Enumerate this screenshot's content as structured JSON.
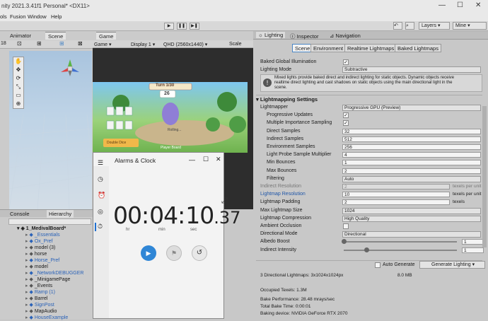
{
  "window": {
    "title": "nity 2021.3.41f1 Personal* <DX11>",
    "min": "—",
    "max": "☐",
    "close": "✕"
  },
  "menu": [
    "ols",
    "Fusion",
    "Window",
    "Help"
  ],
  "toolbar": {
    "play": "▶",
    "pause": "❚❚",
    "step": "▶❚",
    "layers": "Layers",
    "layout": "Mine"
  },
  "left_tabs": [
    "Animator",
    "Scene"
  ],
  "game_tab": {
    "label": "Game",
    "game_dropdown": "Game",
    "display": "Display 1",
    "resolution": "QHD (2560x1440)",
    "scale": "Scale"
  },
  "scene_toolbar_number": "18",
  "game_overlay": {
    "turn": "Turn 1/30",
    "score": "26",
    "rolling": "Rolling...",
    "player_board": "Player Board",
    "double_dice": "Double Dice"
  },
  "clock": {
    "title": "Alarms & Clock",
    "time": {
      "hours": "00",
      "minutes": "04",
      "seconds": "10",
      "hundredths": ".37",
      "hr": "hr",
      "min": "min",
      "sec": "sec"
    },
    "controls": {
      "play": "▶",
      "flag": "⚑",
      "reset": "↺"
    }
  },
  "bottom_tabs": [
    "Console",
    "Hierarchy"
  ],
  "hierarchy": {
    "root": "1_MedivalBoard*",
    "items": [
      {
        "label": "_Essentials",
        "blue": true
      },
      {
        "label": "Ox_Pref",
        "blue": true
      },
      {
        "label": "model (3)",
        "blue": false
      },
      {
        "label": "horse",
        "blue": false
      },
      {
        "label": "Horse_Pref",
        "blue": true
      },
      {
        "label": "model",
        "blue": false
      },
      {
        "label": "_NetworkDEBUGGER",
        "blue": true
      },
      {
        "label": "_MinigamePage",
        "blue": false
      },
      {
        "label": "_Events",
        "blue": false
      },
      {
        "label": "Ramp (1)",
        "blue": true
      },
      {
        "label": "Barrel",
        "blue": false
      },
      {
        "label": "SignPost",
        "blue": true
      },
      {
        "label": "MapAudio",
        "blue": false
      },
      {
        "label": "HouseExample",
        "blue": true
      }
    ]
  },
  "right_tabs": [
    "Lighting",
    "Inspector",
    "Navigation"
  ],
  "lighting": {
    "sub_tabs": [
      "Scene",
      "Environment",
      "Realtime Lightmaps",
      "Baked Lightmaps"
    ],
    "baked_gi_label": "Baked Global Illumination",
    "lighting_mode_label": "Lighting Mode",
    "lighting_mode_value": "Subtractive",
    "help_text": [
      "Mixed lights provide baked direct and indirect lighting for static objects. Dynamic objects receive",
      "realtime direct lighting and cast shadows on static objects using the main directional light in the",
      "scene."
    ],
    "section_title": "Lightmapping Settings",
    "rows": [
      {
        "label": "Lightmapper",
        "type": "dropdown",
        "value": "Progressive GPU (Preview)",
        "indent": 0
      },
      {
        "label": "Progressive Updates",
        "type": "check",
        "value": "✓",
        "indent": 1
      },
      {
        "label": "Multiple Importance Sampling",
        "type": "check",
        "value": "✓",
        "indent": 1
      },
      {
        "label": "Direct Samples",
        "type": "field",
        "value": "32",
        "indent": 1
      },
      {
        "label": "Indirect Samples",
        "type": "field",
        "value": "512",
        "indent": 1
      },
      {
        "label": "Environment Samples",
        "type": "field",
        "value": "256",
        "indent": 1
      },
      {
        "label": "Light Probe Sample Multiplier",
        "type": "field",
        "value": "4",
        "indent": 1
      },
      {
        "label": "Min Bounces",
        "type": "field",
        "value": "1",
        "indent": 1
      },
      {
        "label": "Max Bounces",
        "type": "field",
        "value": "2",
        "indent": 1
      },
      {
        "label": "Filtering",
        "type": "dropdown",
        "value": "Auto",
        "indent": 1
      },
      {
        "label": "Indirect Resolution",
        "type": "field",
        "value": "2",
        "indent": 0,
        "muted": true,
        "suffix": "texels per unit"
      },
      {
        "label": "Lightmap Resolution",
        "type": "field",
        "value": "10",
        "indent": 0,
        "highlight": true,
        "suffix": "texels per unit"
      },
      {
        "label": "Lightmap Padding",
        "type": "field",
        "value": "2",
        "indent": 0,
        "suffix": "texels"
      },
      {
        "label": "Max Lightmap Size",
        "type": "dropdown",
        "value": "1024",
        "indent": 0
      },
      {
        "label": "Lightmap Compression",
        "type": "dropdown",
        "value": "High Quality",
        "indent": 0
      },
      {
        "label": "Ambient Occlusion",
        "type": "check",
        "value": "",
        "indent": 0
      },
      {
        "label": "Directional Mode",
        "type": "dropdown",
        "value": "Directional",
        "indent": 0
      },
      {
        "label": "Albedo Boost",
        "type": "slider",
        "value": "1",
        "level": 0.0,
        "indent": 0
      },
      {
        "label": "Indirect Intensity",
        "type": "slider",
        "value": "1",
        "level": 0.2,
        "indent": 0
      }
    ],
    "auto_generate": "Auto Generate",
    "generate_button": "Generate Lighting",
    "stats": {
      "lightmaps": "3 Directional Lightmaps: 3x1024x1024px",
      "size": "8.0 MB",
      "occupied": "Occupied Texels: 1.3M",
      "performance": "Bake Performance: 28.48 mrays/sec",
      "bake_time": "Total Bake Time: 0:00:01",
      "device": "Baking device: NVIDIA GeForce RTX 2070"
    }
  },
  "colors": {
    "accent": "#4a86c5",
    "link": "#1f56a8",
    "prefab": "#2a62b8"
  }
}
